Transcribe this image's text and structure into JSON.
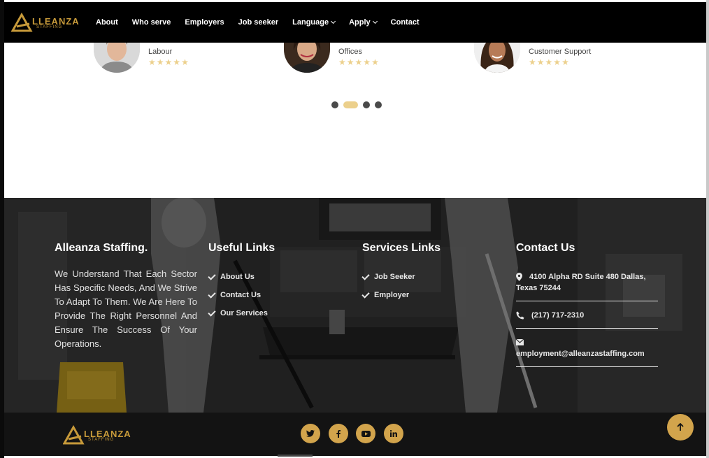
{
  "brand": {
    "logo_word": "LLEANZA",
    "logo_sub": "STAFFING"
  },
  "nav": {
    "about": "About",
    "who_serve": "Who serve",
    "employers": "Employers",
    "job_seeker": "Job seeker",
    "language": "Language",
    "apply": "Apply",
    "contact": "Contact"
  },
  "testimonials": [
    {
      "role": "Labour",
      "rating": 5
    },
    {
      "role": "Offices",
      "rating": 5
    },
    {
      "role": "Customer Support",
      "rating": 5
    }
  ],
  "carousel": {
    "dot_count": 4,
    "active_index": 1
  },
  "footer": {
    "about": {
      "title": "Alleanza Staffing.",
      "text": "We Understand That Each Sector Has Specific Needs, And We Strive To Adapt To Them. We Are Here To Provide The Right Personnel And Ensure The Success Of Your Operations."
    },
    "useful_links": {
      "title": "Useful Links",
      "items": [
        "About Us",
        "Contact Us",
        "Our Services"
      ]
    },
    "services_links": {
      "title": "Services Links",
      "items": [
        "Job Seeker",
        "Employer"
      ]
    },
    "contact": {
      "title": "Contact Us",
      "address": "4100 Alpha RD Suite 480 Dallas, Texas 75244",
      "phone": "(217) 717-2310",
      "email": "employment@alleanzastaffing.com"
    }
  },
  "social": [
    "twitter-icon",
    "facebook-icon",
    "youtube-icon",
    "linkedin-icon"
  ],
  "colors": {
    "gold": "#d2a44c",
    "star": "#ecd08c",
    "nav_bg": "#000000",
    "bottom_bg": "#131313"
  }
}
